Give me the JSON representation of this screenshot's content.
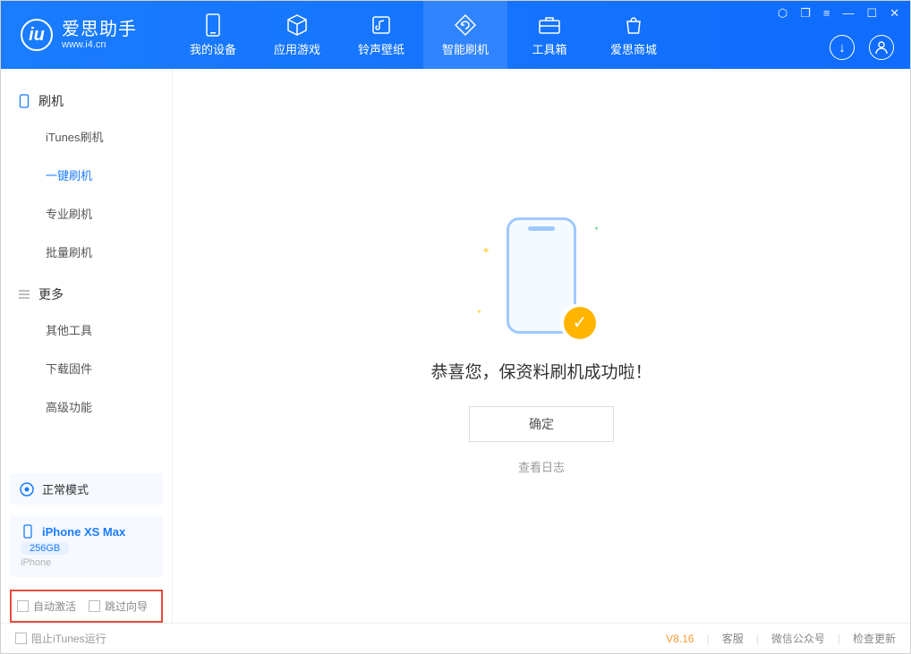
{
  "app": {
    "name_cn": "爱思助手",
    "name_en": "www.i4.cn",
    "logo_letter": "iu"
  },
  "tabs": [
    {
      "label": "我的设备",
      "icon": "device-icon"
    },
    {
      "label": "应用游戏",
      "icon": "cube-icon"
    },
    {
      "label": "铃声壁纸",
      "icon": "music-icon"
    },
    {
      "label": "智能刷机",
      "icon": "refresh-icon",
      "active": true
    },
    {
      "label": "工具箱",
      "icon": "toolbox-icon"
    },
    {
      "label": "爱思商城",
      "icon": "shop-icon"
    }
  ],
  "sidebar": {
    "group1": {
      "title": "刷机",
      "items": [
        "iTunes刷机",
        "一键刷机",
        "专业刷机",
        "批量刷机"
      ],
      "active_index": 1
    },
    "group2": {
      "title": "更多",
      "items": [
        "其他工具",
        "下载固件",
        "高级功能"
      ]
    }
  },
  "device_mode": {
    "label": "正常模式"
  },
  "device": {
    "name": "iPhone XS Max",
    "capacity": "256GB",
    "type": "iPhone"
  },
  "checkboxes": {
    "auto_activate": "自动激活",
    "skip_wizard": "跳过向导"
  },
  "main": {
    "success_msg": "恭喜您，保资料刷机成功啦！",
    "ok_btn": "确定",
    "view_log": "查看日志"
  },
  "footer": {
    "block_itunes": "阻止iTunes运行",
    "version": "V8.16",
    "links": [
      "客服",
      "微信公众号",
      "检查更新"
    ]
  }
}
